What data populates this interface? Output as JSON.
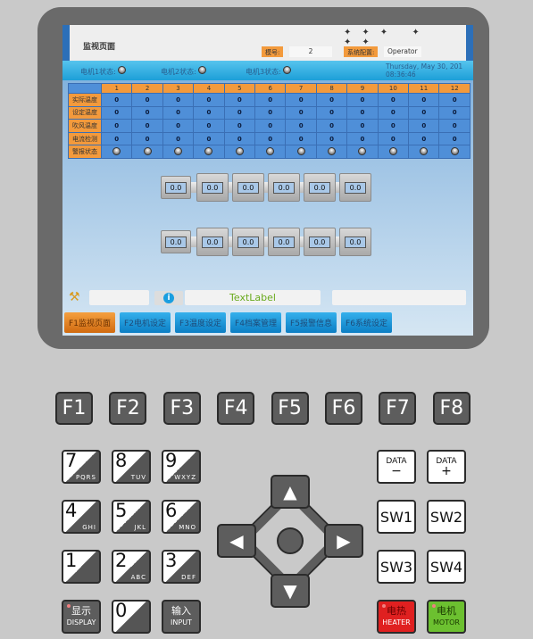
{
  "screen": {
    "title": "监视页面",
    "model_label": "模号:",
    "model_value": "2",
    "config_label": "系统配置:",
    "config_value": "Operator",
    "motors": [
      {
        "label": "电机1状态:"
      },
      {
        "label": "电机2状态:"
      },
      {
        "label": "电机3状态:"
      }
    ],
    "datetime": "Thursday, May 30, 201",
    "time": "08:36:46",
    "table": {
      "columns": [
        "1",
        "2",
        "3",
        "4",
        "5",
        "6",
        "7",
        "8",
        "9",
        "10",
        "11",
        "12"
      ],
      "rows": [
        {
          "label": "实际温度",
          "values": [
            "0",
            "0",
            "0",
            "0",
            "0",
            "0",
            "0",
            "0",
            "0",
            "0",
            "0",
            "0"
          ]
        },
        {
          "label": "设定温度",
          "values": [
            "0",
            "0",
            "0",
            "0",
            "0",
            "0",
            "0",
            "0",
            "0",
            "0",
            "0",
            "0"
          ]
        },
        {
          "label": "吹风温度",
          "values": [
            "0",
            "0",
            "0",
            "0",
            "0",
            "0",
            "0",
            "0",
            "0",
            "0",
            "0",
            "0"
          ]
        },
        {
          "label": "电流检测",
          "values": [
            "0",
            "0",
            "0",
            "0",
            "0",
            "0",
            "0",
            "0",
            "0",
            "0",
            "0",
            "0"
          ]
        }
      ],
      "alarm_label": "警报状态"
    },
    "pipes": [
      [
        "0.0",
        "0.0",
        "0.0",
        "0.0",
        "0.0",
        "0.0"
      ],
      [
        "0.0",
        "0.0",
        "0.0",
        "0.0",
        "0.0",
        "0.0"
      ]
    ],
    "text_label": "TextLabel",
    "text_label_color": "#6aaa1e",
    "tabs": [
      {
        "label": "F1监视页面",
        "active": true
      },
      {
        "label": "F2电机设定"
      },
      {
        "label": "F3温度设定"
      },
      {
        "label": "F4档案管理"
      },
      {
        "label": "F5报警信息"
      },
      {
        "label": "F6系统设定"
      }
    ]
  },
  "keypad": {
    "function_keys": [
      "F1",
      "F2",
      "F3",
      "F4",
      "F5",
      "F6",
      "F7",
      "F8"
    ],
    "numeric": [
      {
        "d": "7",
        "l": "PQRS"
      },
      {
        "d": "8",
        "l": "TUV"
      },
      {
        "d": "9",
        "l": "WXYZ"
      },
      {
        "d": "4",
        "l": "GHI"
      },
      {
        "d": "5",
        "l": "JKL"
      },
      {
        "d": "6",
        "l": "MNO"
      },
      {
        "d": "1",
        "l": ""
      },
      {
        "d": "2",
        "l": "ABC"
      },
      {
        "d": "3",
        "l": "DEF"
      }
    ],
    "zero": "0",
    "display": {
      "cn": "显示",
      "en": "DISPLAY"
    },
    "input": {
      "cn": "输入",
      "en": "INPUT"
    },
    "data_minus": {
      "top": "DATA",
      "sign": "−"
    },
    "data_plus": {
      "top": "DATA",
      "sign": "+"
    },
    "sw": [
      "SW1",
      "SW2",
      "SW3",
      "SW4"
    ],
    "heater": {
      "cn": "电热",
      "en": "HEATER",
      "color": "#e02020"
    },
    "motor": {
      "cn": "电机",
      "en": "MOTOR",
      "color": "#6cc030"
    }
  }
}
